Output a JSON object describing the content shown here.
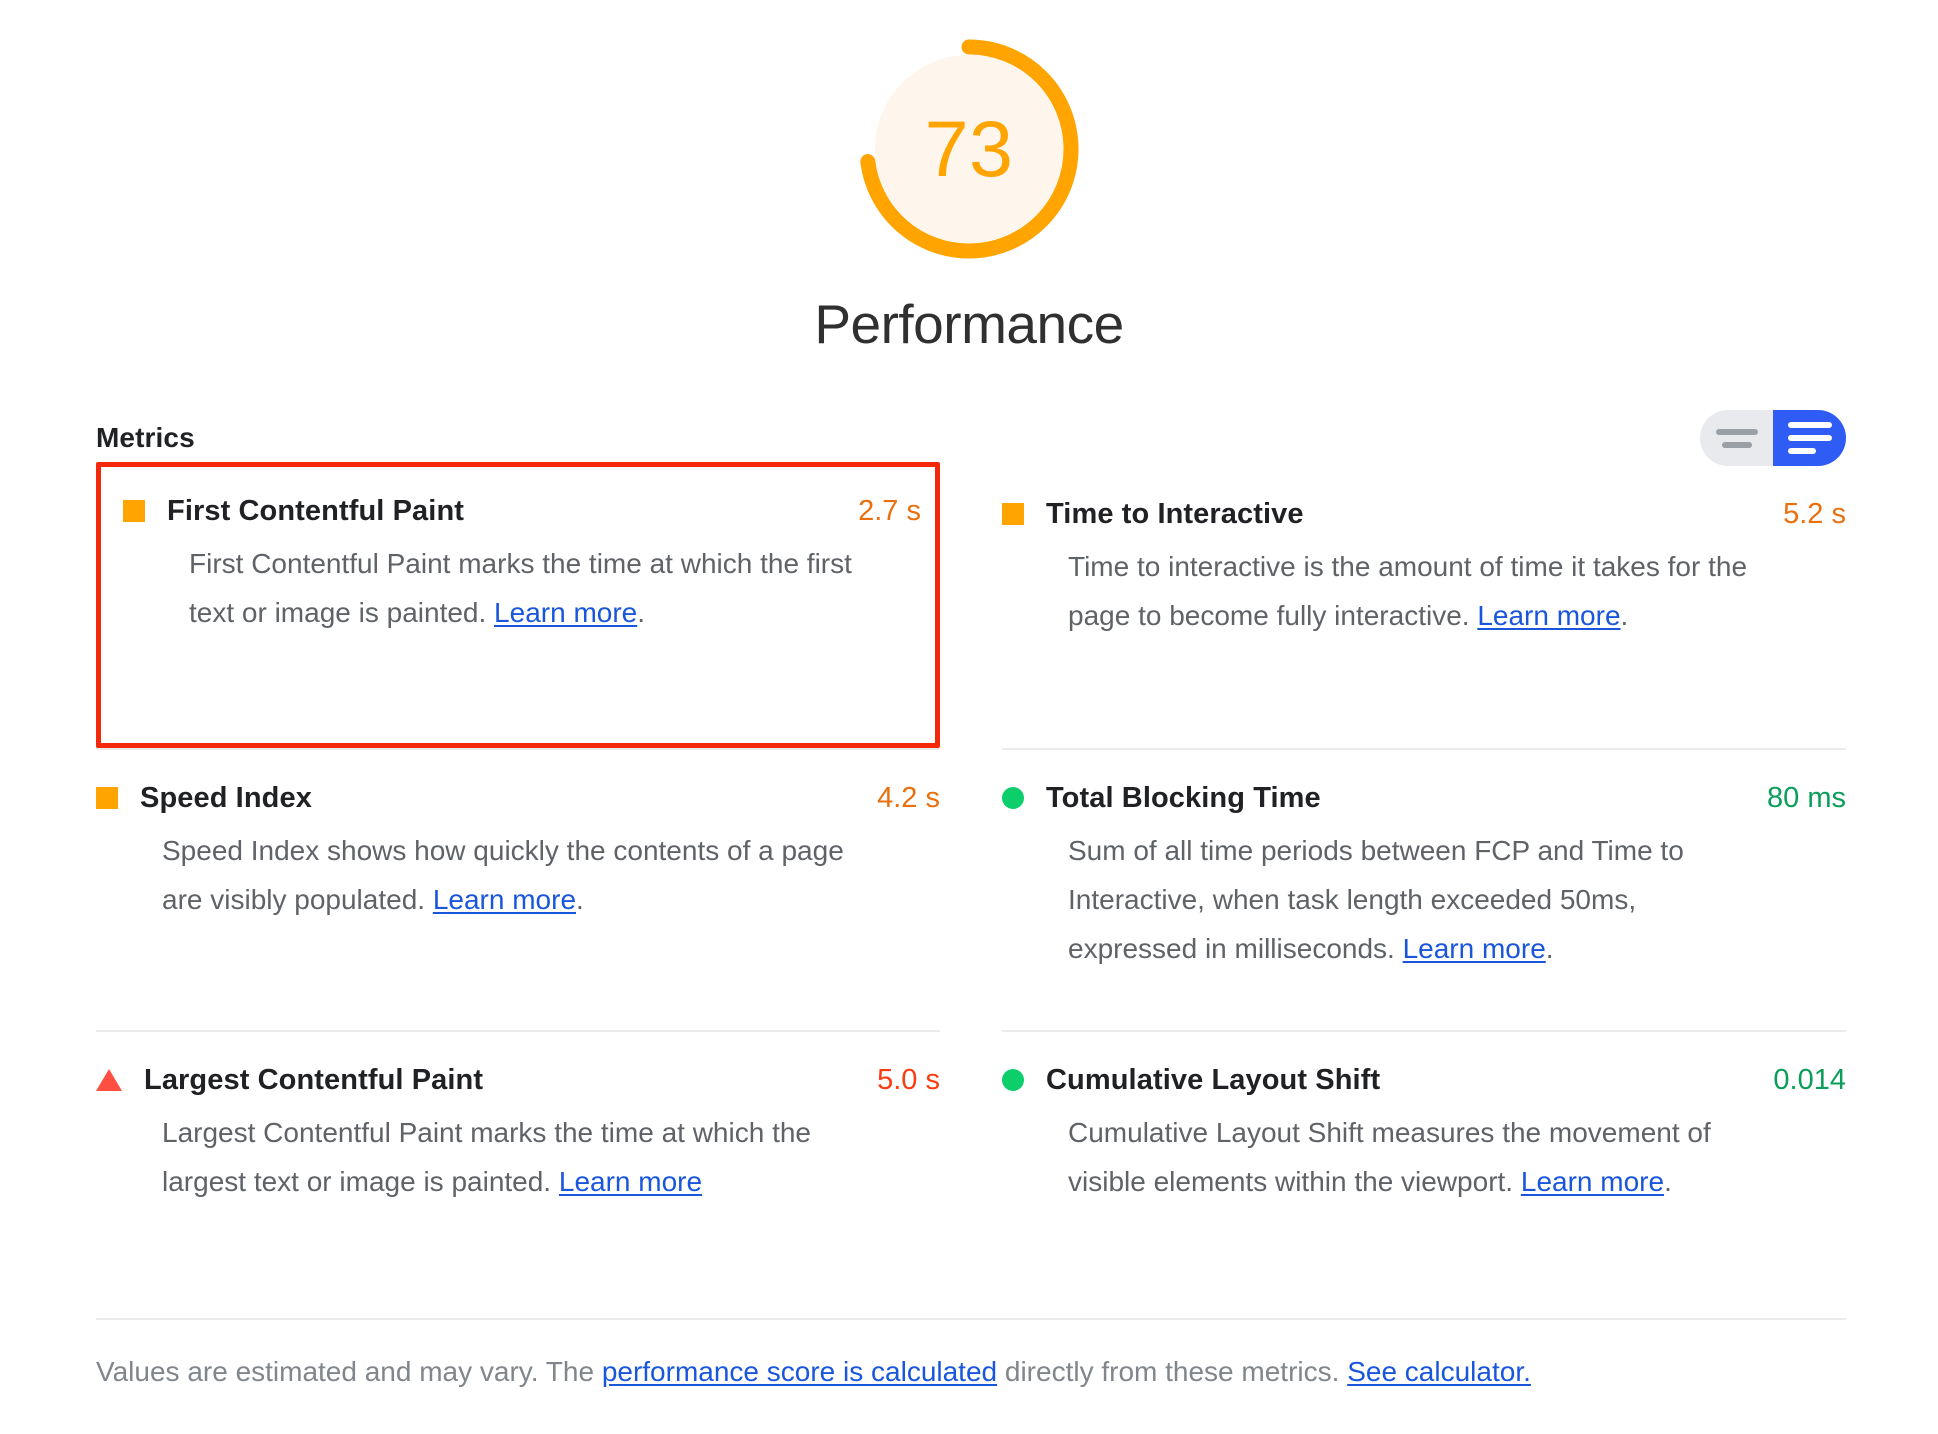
{
  "gauge": {
    "score": "73",
    "percent": 73,
    "title": "Performance",
    "arc_color": "#ffa400",
    "fill_color": "#fef6ec",
    "score_color": "#ffa400"
  },
  "metrics_section": {
    "heading": "Metrics",
    "toggle": {
      "name": "view-density-toggle",
      "collapsed_label": "compact-view",
      "expanded_label": "expanded-view",
      "selected": "expanded-view",
      "inactive_color": "#e8eaed",
      "active_color": "#2f5cf5"
    },
    "metrics": [
      {
        "name": "First Contentful Paint",
        "value": "2.7 s",
        "value_class": "v-orange",
        "indicator": "square-orange-icon",
        "indicator_shape": "ind-square",
        "description_before": "First Contentful Paint marks the time at which the first text or image is painted. ",
        "link_text": "Learn more",
        "description_after": ".",
        "highlighted": true
      },
      {
        "name": "Time to Interactive",
        "value": "5.2 s",
        "value_class": "v-orange",
        "indicator": "square-orange-icon",
        "indicator_shape": "ind-square",
        "description_before": "Time to interactive is the amount of time it takes for the page to become fully interactive. ",
        "link_text": "Learn more",
        "description_after": ".",
        "highlighted": false
      },
      {
        "name": "Speed Index",
        "value": "4.2 s",
        "value_class": "v-orange",
        "indicator": "square-orange-icon",
        "indicator_shape": "ind-square",
        "description_before": "Speed Index shows how quickly the contents of a page are visibly populated. ",
        "link_text": "Learn more",
        "description_after": ".",
        "highlighted": false
      },
      {
        "name": "Total Blocking Time",
        "value": "80 ms",
        "value_class": "v-green",
        "indicator": "circle-green-icon",
        "indicator_shape": "ind-circle",
        "description_before": "Sum of all time periods between FCP and Time to Interactive, when task length exceeded 50ms, expressed in milliseconds. ",
        "link_text": "Learn more",
        "description_after": ".",
        "highlighted": false
      },
      {
        "name": "Largest Contentful Paint",
        "value": "5.0 s",
        "value_class": "v-red",
        "indicator": "triangle-red-icon",
        "indicator_shape": "ind-triangle",
        "description_before": "Largest Contentful Paint marks the time at which the largest text or image is painted. ",
        "link_text": "Learn more",
        "description_after": "",
        "highlighted": false
      },
      {
        "name": "Cumulative Layout Shift",
        "value": "0.014",
        "value_class": "v-green",
        "indicator": "circle-green-icon",
        "indicator_shape": "ind-circle",
        "description_before": "Cumulative Layout Shift measures the movement of visible elements within the viewport. ",
        "link_text": "Learn more",
        "description_after": ".",
        "highlighted": false
      }
    ]
  },
  "footer": {
    "text_1": "Values are estimated and may vary. The ",
    "link_1": "performance score is calculated",
    "text_2": " directly from these metrics. ",
    "link_2": "See calculator."
  },
  "colors": {
    "orange": "#ffa400",
    "green": "#0cce6b",
    "red": "#ff4e42",
    "link_blue": "#1a56db",
    "highlight_border": "#f4290b",
    "text_dark": "#202124",
    "text_gray": "#5f6368"
  }
}
